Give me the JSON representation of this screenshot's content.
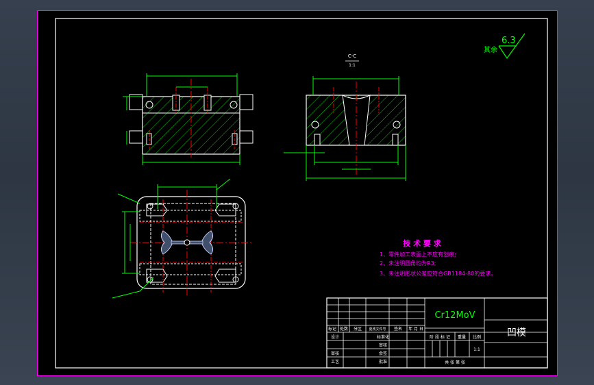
{
  "drawing": {
    "section_label": "C-C",
    "section_scale": "1:1",
    "surface_finish": {
      "value": "6.3",
      "label": "其余"
    },
    "tech_requirements": {
      "title": "技 术 要 求",
      "items": [
        "1、零件加工表面上不应有划痕;",
        "2、未注明圆角均为R3;",
        "3、未注明形状公差应符合GB1184-80的要求。"
      ]
    },
    "title_block": {
      "material": "Cr12MoV",
      "part_name": "凹模",
      "scale": "1:1",
      "rev_headers": [
        "标记",
        "处数",
        "分区",
        "更改文件号",
        "签名",
        "年 月 日"
      ],
      "sign_rows": [
        "设计",
        "审核",
        "工艺"
      ],
      "mid_labels": [
        "标准化",
        "审核",
        "会签",
        "批准"
      ],
      "stage_headers": [
        "阶 段 标 记",
        "重量",
        "比例"
      ],
      "sheets_text": "共   张   第   张"
    },
    "colors": {
      "outline": "#ffffff",
      "hatch": "#00ff00",
      "centerline": "#ff0000",
      "dimension": "#00ff00",
      "text_notes": "#ff00ff",
      "title_text": "#ffffff",
      "frame": "#ff00ff"
    }
  }
}
